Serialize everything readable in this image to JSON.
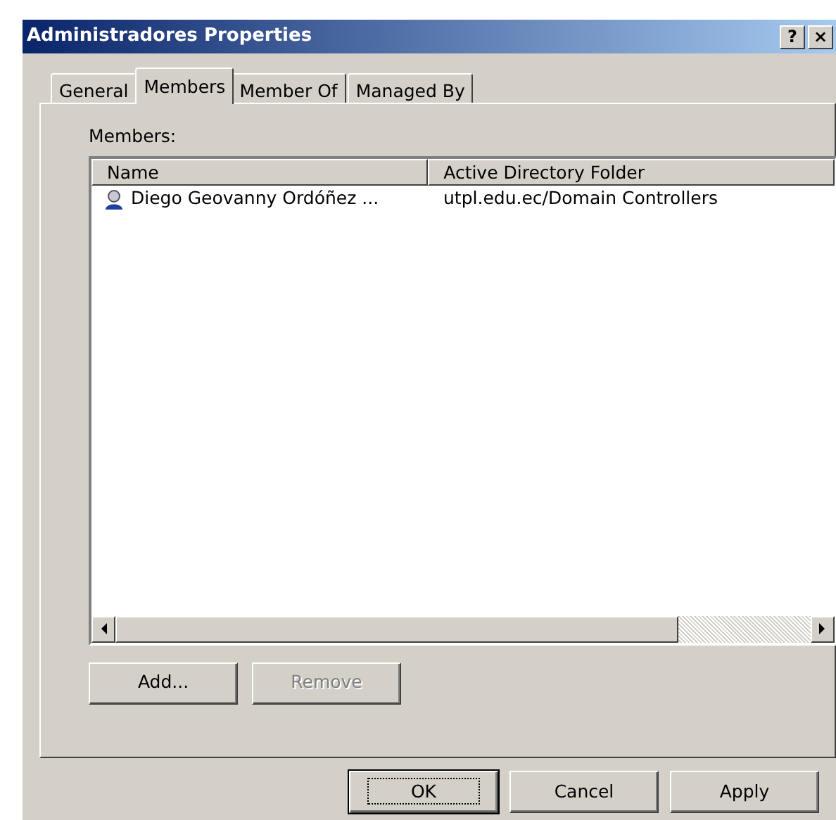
{
  "window": {
    "title": "Administradores Properties",
    "title_buttons": [
      "?",
      "×"
    ]
  },
  "tabs": [
    {
      "label": "General",
      "selected": false
    },
    {
      "label": "Members",
      "selected": true
    },
    {
      "label": "Member Of",
      "selected": false
    },
    {
      "label": "Managed By",
      "selected": false
    }
  ],
  "members_label": {
    "text": "Members:"
  },
  "table": {
    "columns": [
      "Name",
      "Active Directory Folder"
    ],
    "rows": [
      {
        "name": "Diego Geovanny Ordóñez ...",
        "folder": "utpl.edu.ec/Domain Controllers",
        "selected": false
      }
    ]
  },
  "list_buttons": [
    {
      "label": "Add...",
      "disabled": false
    },
    {
      "label": "Remove",
      "disabled": true
    }
  ],
  "dialog_buttons": [
    {
      "label": "OK",
      "default": true
    },
    {
      "label": "Cancel",
      "default": false
    },
    {
      "label": "Apply",
      "default": false
    }
  ]
}
